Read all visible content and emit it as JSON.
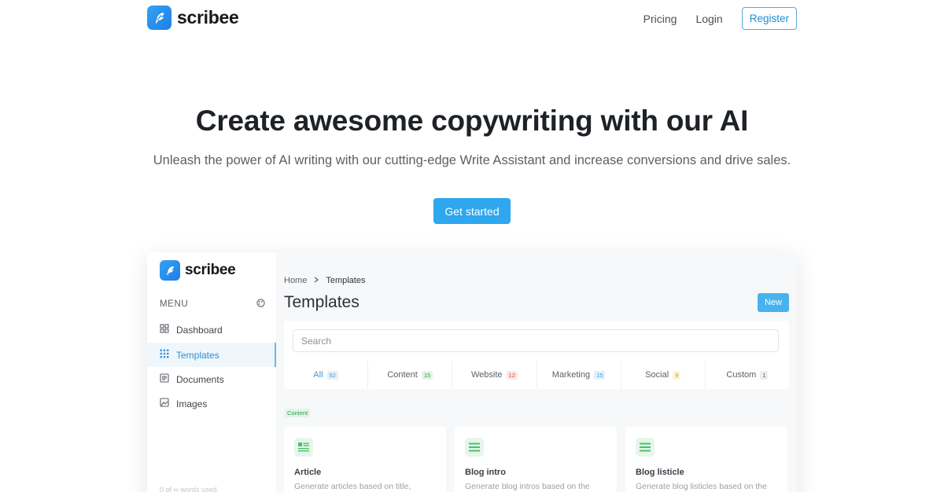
{
  "header": {
    "brand": "scribee",
    "nav": [
      {
        "label": "Pricing"
      },
      {
        "label": "Login"
      }
    ],
    "register_label": "Register"
  },
  "hero": {
    "title": "Create awesome copywriting with our AI",
    "subtitle": "Unleash the power of AI writing with our cutting-edge Write Assistant and increase conversions and drive sales.",
    "cta_label": "Get started"
  },
  "app": {
    "brand": "scribee",
    "menu_heading": "MENU",
    "sidebar": {
      "items": [
        {
          "label": "Dashboard",
          "icon": "grid-icon"
        },
        {
          "label": "Templates",
          "icon": "dots-grid-icon",
          "active": true
        },
        {
          "label": "Documents",
          "icon": "document-icon"
        },
        {
          "label": "Images",
          "icon": "image-icon"
        }
      ],
      "footer": "0 of ∞ words used."
    },
    "breadcrumb": {
      "home": "Home",
      "current": "Templates"
    },
    "page_title": "Templates",
    "new_label": "New",
    "search_placeholder": "Search",
    "tabs": [
      {
        "label": "All",
        "count": "52",
        "active": true,
        "color": "#3a9be0"
      },
      {
        "label": "Content",
        "count": "15",
        "color": "#2f9d4f"
      },
      {
        "label": "Website",
        "count": "12",
        "color": "#d64b4b"
      },
      {
        "label": "Marketing",
        "count": "15",
        "color": "#3a9be0"
      },
      {
        "label": "Social",
        "count": "9",
        "color": "#c49a14"
      },
      {
        "label": "Custom",
        "count": "1",
        "color": "#5a6068"
      }
    ],
    "section_label": "Content",
    "cards": [
      {
        "title": "Article",
        "desc": "Generate articles based on title,"
      },
      {
        "title": "Blog intro",
        "desc": "Generate blog intros based on the"
      },
      {
        "title": "Blog listicle",
        "desc": "Generate blog listicles based on the"
      }
    ]
  },
  "colors": {
    "accent": "#2ea7ef",
    "brand_gradient_start": "#35a2f3",
    "brand_gradient_end": "#1e7ee6"
  }
}
